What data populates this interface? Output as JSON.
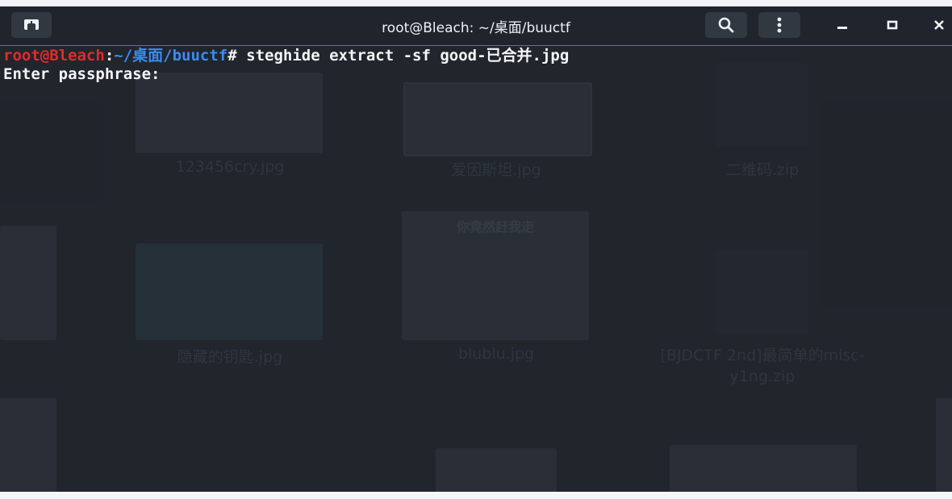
{
  "window": {
    "title": "root@Bleach: ~/桌面/buuctf",
    "new_tab_icon": "new-tab-icon",
    "search_icon": "search-icon",
    "menu_icon": "kebab-menu-icon",
    "minimize_icon": "minimize-icon",
    "maximize_icon": "maximize-icon",
    "close_icon": "close-icon"
  },
  "terminal": {
    "prompt_user_host": "root@Bleach",
    "prompt_sep": ":",
    "prompt_path": "~/桌面/buuctf",
    "prompt_symbol": "#",
    "command": " steghide extract -sf good-已合并.jpg",
    "output_line": "Enter passphrase:"
  },
  "desktop_behind": {
    "files": [
      {
        "name": "123456cry.jpg"
      },
      {
        "name": "爱因斯坦.jpg"
      },
      {
        "name": "二维码.zip"
      },
      {
        "name": "隐藏的钥匙.jpg"
      },
      {
        "name": "blublu.jpg"
      },
      {
        "name": "[BJDCTF 2nd]最简单的misc-y1ng.zip"
      }
    ],
    "sticker_text": "你竟然赶我走"
  },
  "colors": {
    "prompt_user": "#e12b2b",
    "prompt_path": "#3b8bf1",
    "titlebar_accent": "#3c78d0",
    "terminal_bg": "#1a1e25"
  }
}
